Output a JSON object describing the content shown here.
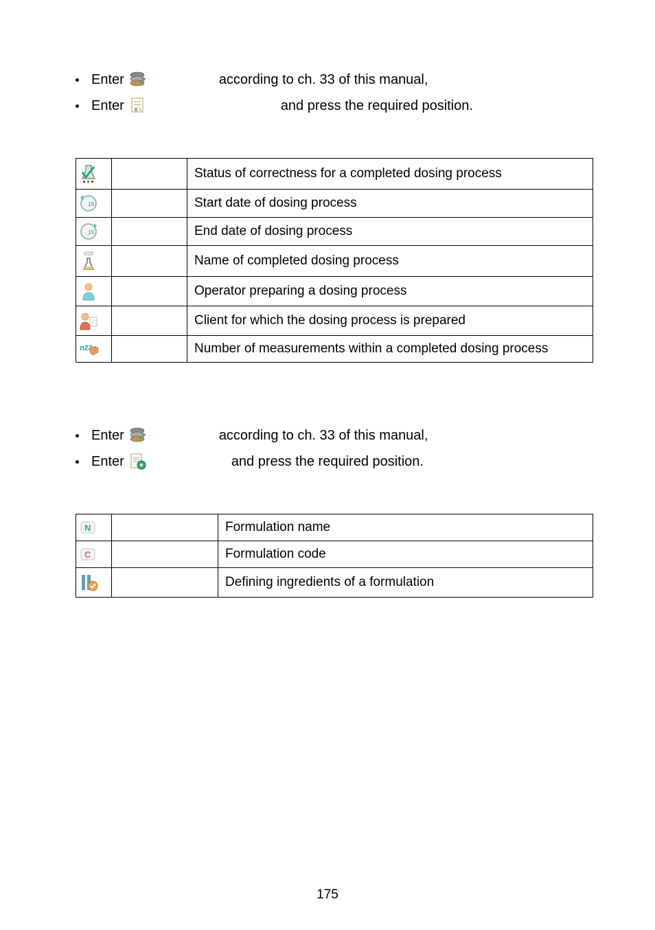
{
  "bullets1": {
    "item1_prefix": "Enter",
    "item1_suffix": "according to ch. 33 of this manual,",
    "item2_prefix": "Enter",
    "item2_suffix": "and press the required position."
  },
  "table1": {
    "rows": [
      {
        "description": "Status of correctness for a completed dosing process"
      },
      {
        "description": "Start date of dosing process"
      },
      {
        "description": "End date of dosing process"
      },
      {
        "description": "Name of completed dosing process"
      },
      {
        "description": "Operator preparing a dosing process"
      },
      {
        "description": "Client for which the dosing process is prepared"
      },
      {
        "description": "Number of measurements within a completed dosing process"
      }
    ]
  },
  "bullets2": {
    "item1_prefix": "Enter",
    "item1_suffix": "according to ch. 33 of this manual,",
    "item2_prefix": "Enter",
    "item2_suffix": "and press the required position."
  },
  "table2": {
    "rows": [
      {
        "description": "Formulation name"
      },
      {
        "description": "Formulation code"
      },
      {
        "description": "Defining ingredients of a formulation"
      }
    ]
  },
  "page_number": "175"
}
